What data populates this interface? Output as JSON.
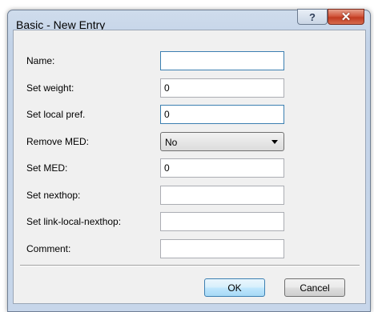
{
  "window": {
    "title": "Basic - New Entry",
    "help_glyph": "?",
    "close_glyph": "✕"
  },
  "form": {
    "name": {
      "label": "Name:",
      "value": ""
    },
    "set_weight": {
      "label": "Set weight:",
      "value": "0"
    },
    "set_local_pref": {
      "label": "Set local pref.",
      "value": "0"
    },
    "remove_med": {
      "label": "Remove MED:",
      "value": "No"
    },
    "set_med": {
      "label": "Set MED:",
      "value": "0"
    },
    "set_nexthop": {
      "label": "Set nexthop:",
      "value": ""
    },
    "set_link_local_nexthop": {
      "label": "Set link-local-nexthop:",
      "value": ""
    },
    "comment": {
      "label": "Comment:",
      "value": ""
    }
  },
  "buttons": {
    "ok": "OK",
    "cancel": "Cancel"
  }
}
